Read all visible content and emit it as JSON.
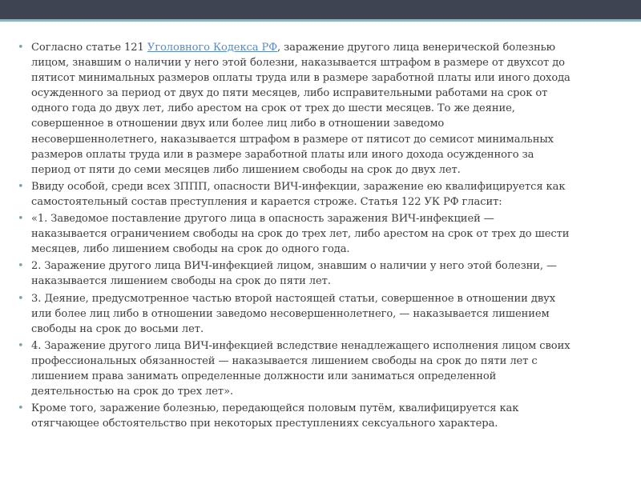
{
  "slide": {
    "bullet_glyph": "•",
    "paragraphs": [
      {
        "before": "Согласно статье 121 ",
        "link": "Уголовного Кодекса РФ",
        "after": ", заражение другого лица венерической болезнью лицом, знавшим о наличии у него этой болезни, наказывается штрафом в размере от двухсот до пятисот минимальных размеров оплаты труда или в размере заработной платы или иного дохода осужденного за период от двух до пяти месяцев, либо исправительными работами на срок от одного года до двух лет, либо арестом на срок от трех до шести месяцев. То же деяние, совершенное в отношении двух или более лиц либо в отношении заведомо несовершеннолетнего, наказывается штрафом в размере от пятисот до семисот минимальных размеров оплаты труда или в размере заработной платы или иного дохода осужденного за период от пяти до семи месяцев либо лишением свободы на срок до двух лет."
      },
      {
        "text": "Ввиду особой, среди всех ЗППП, опасности ВИЧ-инфекции, заражение ею квалифицируется как самостоятельный состав преступления и карается строже. Статья 122 УК РФ гласит:"
      },
      {
        "text": "«1. Заведомое поставление другого лица в опасность заражения ВИЧ-инфекцией — наказывается ограничением свободы на срок до трех лет, либо арестом на срок от трех до шести месяцев, либо лишением свободы на срок до одного года."
      },
      {
        "text": "2. Заражение другого лица ВИЧ-инфекцией лицом, знавшим о наличии у него этой болезни, — наказывается лишением свободы на срок до пяти лет."
      },
      {
        "text": "3. Деяние, предусмотренное частью второй настоящей статьи, совершенное в отношении двух или более лиц либо в отношении заведомо несовершеннолетнего, — наказывается лишением свободы на срок до восьми лет."
      },
      {
        "text": "4. Заражение другого лица ВИЧ-инфекцией вследствие ненадлежащего исполнения лицом своих профессиональных обязанностей — наказывается лишением свободы на срок до пяти лет с лишением права занимать определенные должности или заниматься определенной деятельностью на срок до трех лет»."
      },
      {
        "text": "Кроме того, заражение болезнью, передающейся половым путём, квалифицируется как отягчающее обстоятельство при некоторых преступлениях сексуального характера."
      }
    ]
  }
}
